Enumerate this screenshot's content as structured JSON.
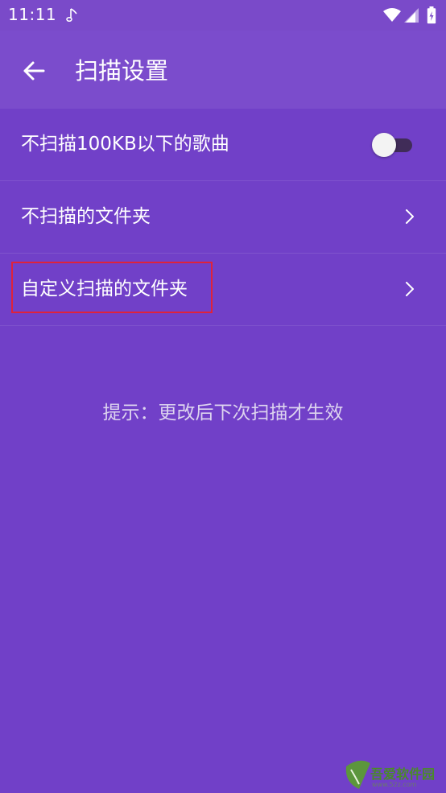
{
  "status_bar": {
    "time": "11:11",
    "icons": [
      "music-note-icon",
      "wifi-icon",
      "cell-signal-icon",
      "battery-charging-icon"
    ]
  },
  "app_bar": {
    "back_icon": "arrow-left-icon",
    "title": "扫描设置"
  },
  "settings": {
    "items": [
      {
        "label": "不扫描100KB以下的歌曲",
        "control": "toggle",
        "enabled": false
      },
      {
        "label": "不扫描的文件夹",
        "control": "chevron",
        "icon": "chevron-right-icon"
      },
      {
        "label": "自定义扫描的文件夹",
        "control": "chevron",
        "icon": "chevron-right-icon",
        "highlighted": true
      }
    ]
  },
  "hint": "提示：更改后下次扫描才生效",
  "watermark": {
    "text": "吾爱软件园",
    "url": "www.52z.com"
  },
  "colors": {
    "background": "#7140c8",
    "app_bar": "#7b4ccc",
    "highlight": "#e0223a"
  }
}
